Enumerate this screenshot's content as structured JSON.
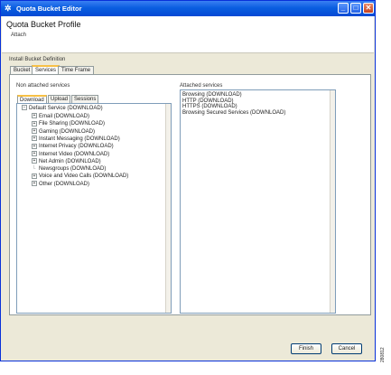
{
  "window": {
    "title": "Quota Bucket Editor",
    "title_icon": "gear-icon",
    "minimize_glyph": "_",
    "maximize_glyph": "□",
    "close_glyph": "✕"
  },
  "header": {
    "title": "Quota Bucket Profile",
    "subtitle": "Attach"
  },
  "group_label": "Install Bucket Definition",
  "tabs": [
    {
      "label": "Bucket"
    },
    {
      "label": "Services"
    },
    {
      "label": "Time Frame"
    }
  ],
  "left_label": "Non attached services",
  "right_label": "Attached services",
  "subtabs": [
    {
      "label": "Download"
    },
    {
      "label": "Upload"
    },
    {
      "label": "Sessions"
    }
  ],
  "tree": {
    "root": "Default Service (DOWNLOAD)",
    "children": [
      "Email (DOWNLOAD)",
      "File Sharing (DOWNLOAD)",
      "Gaming (DOWNLOAD)",
      "Instant Messaging (DOWNLOAD)",
      "Internet Privacy (DOWNLOAD)",
      "Internet Video (DOWNLOAD)",
      "Net Admin (DOWNLOAD)",
      "Newsgroups (DOWNLOAD)",
      "Voice and Video Calls (DOWNLOAD)",
      "Other (DOWNLOAD)"
    ],
    "leaf_index": 7
  },
  "attached": [
    "Browsing (DOWNLOAD)",
    "HTTP (DOWNLOAD)",
    "HTTPS (DOWNLOAD)",
    "Browsing Secured Services (DOWNLOAD)"
  ],
  "buttons": {
    "finish": "Finish",
    "cancel": "Cancel"
  },
  "side_number": "280812"
}
